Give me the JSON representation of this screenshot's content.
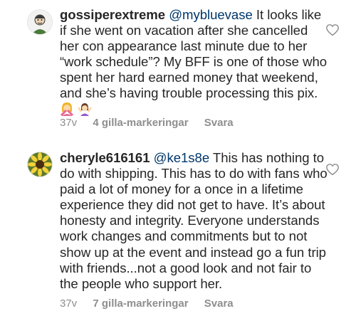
{
  "comments": [
    {
      "username": "gossiperextreme",
      "mention": "@mybluevase",
      "text": "It looks like if she went on vacation after she cancelled her con appearance last minute due to her “work schedule”? My BFF is one of those who spent her hard earned money that weekend, and she’s having trouble processing this pix.",
      "emojis": [
        "woman-gesturing-no",
        "woman-shrugging"
      ],
      "time": "37v",
      "likes": "4 gilla-markeringar",
      "reply": "Svara",
      "avatar_icon": "cartoon-avatar-icon"
    },
    {
      "username": "cheryle616161",
      "mention": "@ke1s8e",
      "text": "This has nothing to do with shipping. This has to do with fans who paid a lot of money for a once in a lifetime experience they did not get to have. It’s about honesty and integrity. Everyone understands work changes and commitments but to not show up at the event and instead go a fun trip with friends...not a good look and not fair to the people who support her.",
      "time": "37v",
      "likes": "7 gilla-markeringar",
      "reply": "Svara",
      "avatar_icon": "flower-avatar-icon"
    }
  ],
  "colors": {
    "text": "#262626",
    "mention": "#00376b",
    "meta": "#8e8e8e",
    "heart": "#8e8e8e"
  }
}
